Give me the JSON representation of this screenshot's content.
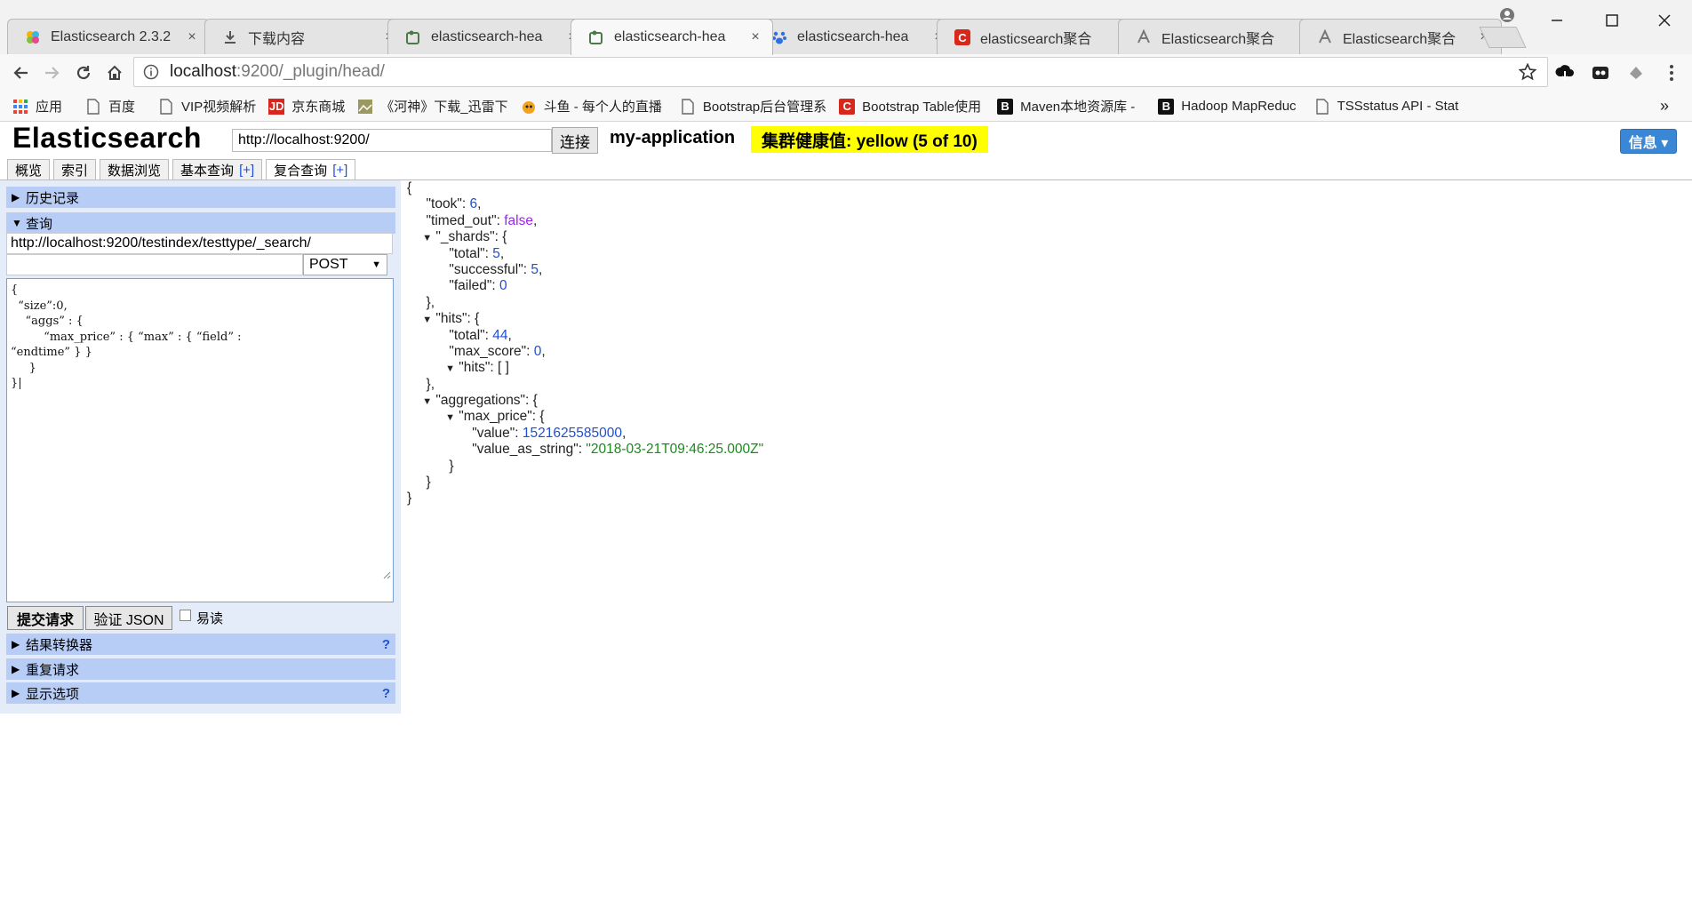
{
  "browser": {
    "tabs": [
      {
        "title": "Elasticsearch 2.3.2",
        "icon": "elastic-flower-icon",
        "active": false
      },
      {
        "title": "下载内容",
        "icon": "download-icon",
        "active": false
      },
      {
        "title": "elasticsearch-hea",
        "icon": "plugin-icon",
        "active": false
      },
      {
        "title": "elasticsearch-hea",
        "icon": "plugin-icon",
        "active": true
      },
      {
        "title": "elasticsearch-hea",
        "icon": "baidu-paw-icon",
        "active": false
      },
      {
        "title": "elasticsearch聚合",
        "icon": "csdn-icon",
        "active": false
      },
      {
        "title": "Elasticsearch聚合",
        "icon": "site-icon",
        "active": false
      },
      {
        "title": "Elasticsearch聚合",
        "icon": "site-icon",
        "active": false
      }
    ],
    "tab_close": "×",
    "address": {
      "host": "localhost",
      "rest": ":9200/_plugin/head/"
    },
    "bookmarks": [
      {
        "label": "应用",
        "icon": "apps-grid-icon"
      },
      {
        "label": "百度",
        "icon": "page-icon"
      },
      {
        "label": "VIP视频解析",
        "icon": "page-icon"
      },
      {
        "label": "京东商城",
        "icon": "jd-icon"
      },
      {
        "label": "《河神》下载_迅雷下",
        "icon": "image-icon"
      },
      {
        "label": "斗鱼 - 每个人的直播",
        "icon": "douyu-icon"
      },
      {
        "label": "Bootstrap后台管理系",
        "icon": "page-icon"
      },
      {
        "label": "Bootstrap Table使用",
        "icon": "csdn-icon"
      },
      {
        "label": "Maven本地资源库 -",
        "icon": "b-icon"
      },
      {
        "label": "Hadoop MapReduc",
        "icon": "b-icon"
      },
      {
        "label": "TSSstatus API - Stat",
        "icon": "page-icon"
      }
    ],
    "bookmarks_more": "»"
  },
  "app": {
    "title": "Elasticsearch",
    "host_value": "http://localhost:9200/",
    "connect_label": "连接",
    "cluster_name": "my-application",
    "cluster_health": "集群健康值: yellow (5 of 10)",
    "info_label": "信息 ▾",
    "tabs": [
      {
        "label": "概览",
        "plus": ""
      },
      {
        "label": "索引",
        "plus": ""
      },
      {
        "label": "数据浏览",
        "plus": ""
      },
      {
        "label": "基本查询",
        "plus": "[+]"
      },
      {
        "label": "复合查询",
        "plus": "[+]"
      }
    ]
  },
  "left": {
    "history_label": "历史记录",
    "query_label": "查询",
    "query_url": "http://localhost:9200/testindex/testtype/_search/",
    "query_path": "",
    "method": "POST",
    "body_lines": [
      "{",
      "  “size”:0,",
      "    “aggs” : {",
      "         “max_price” : { “max” : { “field” :",
      "“endtime” } }",
      "     }",
      "}|"
    ],
    "submit_label": "提交请求",
    "validate_label": "验证 JSON",
    "pretty_label": "易读",
    "transformer_label": "结果转换器",
    "repeat_label": "重复请求",
    "display_label": "显示选项",
    "help": "?"
  },
  "result": {
    "took": "6",
    "timed_out": "false",
    "shards_total": "5",
    "shards_successful": "5",
    "shards_failed": "0",
    "hits_total": "44",
    "max_score": "0",
    "hits_hits": "[ ]",
    "agg_name": "max_price",
    "agg_value": "1521625585000",
    "agg_value_as_string": "\"2018-03-21T09:46:25.000Z\""
  }
}
